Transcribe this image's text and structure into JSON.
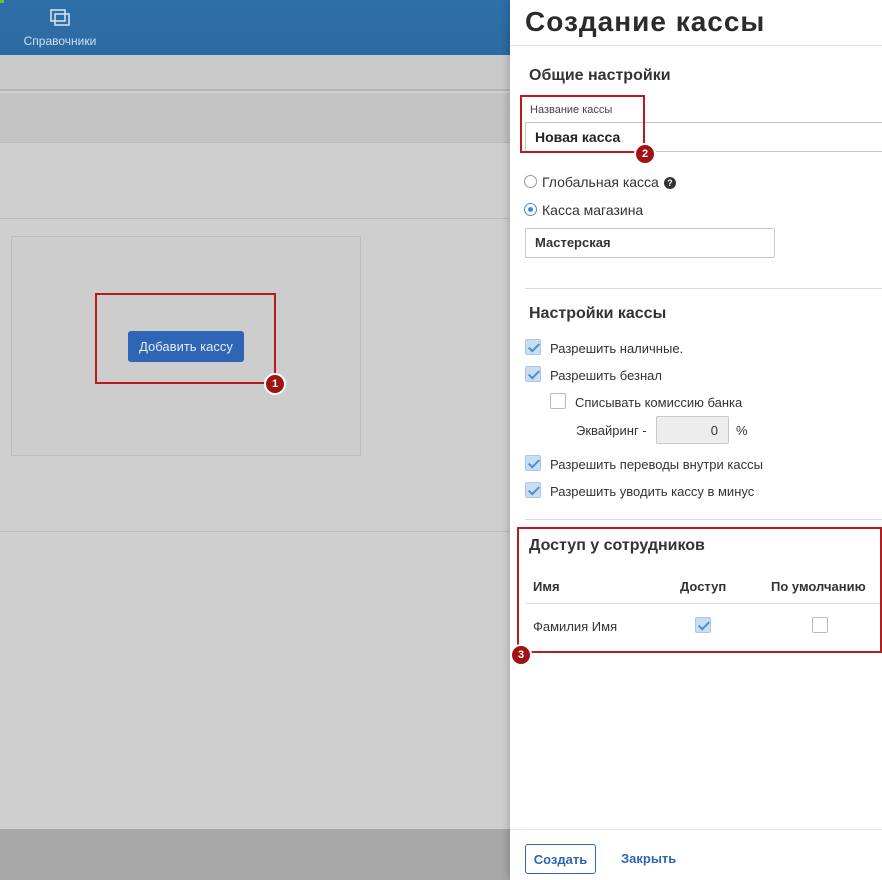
{
  "header": {
    "nav_directories_label": "Справочники"
  },
  "background": {
    "add_cash_button_label": "Добавить кассу"
  },
  "annotations": {
    "badge_1": "1",
    "badge_2": "2",
    "badge_3": "3"
  },
  "panel": {
    "title": "Создание кассы",
    "general_section": {
      "title": "Общие настройки",
      "name_label": "Название кассы",
      "name_value": "Новая касса",
      "radio_global_label": "Глобальная касса",
      "radio_store_label": "Касса магазина",
      "store_value": "Мастерская"
    },
    "cash_settings": {
      "title": "Настройки кассы",
      "allow_cash_label": "Разрешить наличные.",
      "allow_cash_checked": true,
      "allow_cashless_label": "Разрешить безнал",
      "allow_cashless_checked": true,
      "bank_commission_label": "Списывать комиссию банка",
      "bank_commission_checked": false,
      "acquiring_label": "Эквайринг -",
      "acquiring_value": "0",
      "acquiring_unit": "%",
      "allow_transfers_label": "Разрешить переводы внутри кассы",
      "allow_transfers_checked": true,
      "allow_negative_label": "Разрешить уводить кассу в минус",
      "allow_negative_checked": true
    },
    "employee_access": {
      "title": "Доступ у сотрудников",
      "columns": [
        "Имя",
        "Доступ",
        "По умолчанию"
      ],
      "rows": [
        {
          "name": "Фамилия Имя",
          "access": true,
          "default": false
        }
      ]
    },
    "footer": {
      "create_label": "Создать",
      "close_label": "Закрыть"
    }
  },
  "colors": {
    "accent": "#2e66b5",
    "annotation": "#b71c1c",
    "topbar": "#2f6fa8"
  }
}
